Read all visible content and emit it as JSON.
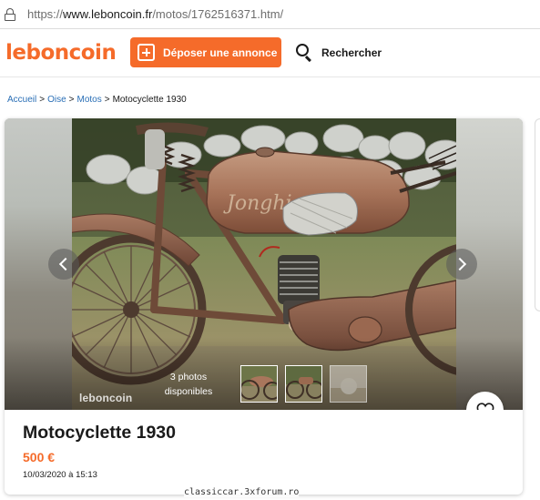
{
  "browser": {
    "url_prefix": "https://",
    "url_domain": "www.leboncoin.fr",
    "url_path": "/motos/1762516371.htm/"
  },
  "header": {
    "logo": "leboncoin",
    "post_ad_label": "Déposer une annonce",
    "search_label": "Rechercher",
    "brand_color": "#f56b2a"
  },
  "breadcrumb": {
    "items": [
      "Accueil",
      "Oise",
      "Motos"
    ],
    "current": "Motocyclette 1930",
    "separator": ">"
  },
  "listing": {
    "watermark": "leboncoin",
    "photos_count_line1": "3 photos",
    "photos_count_line2": "disponibles",
    "tank_lettering": "Jonghi",
    "title": "Motocyclette 1930",
    "price": "500 €",
    "date": "10/03/2020 à 15:13"
  },
  "footer_watermark": "classiccar.3xforum.ro",
  "icons": [
    "lock-icon",
    "plus-square-icon",
    "search-icon",
    "chevron-left-icon",
    "chevron-right-icon",
    "heart-icon"
  ]
}
